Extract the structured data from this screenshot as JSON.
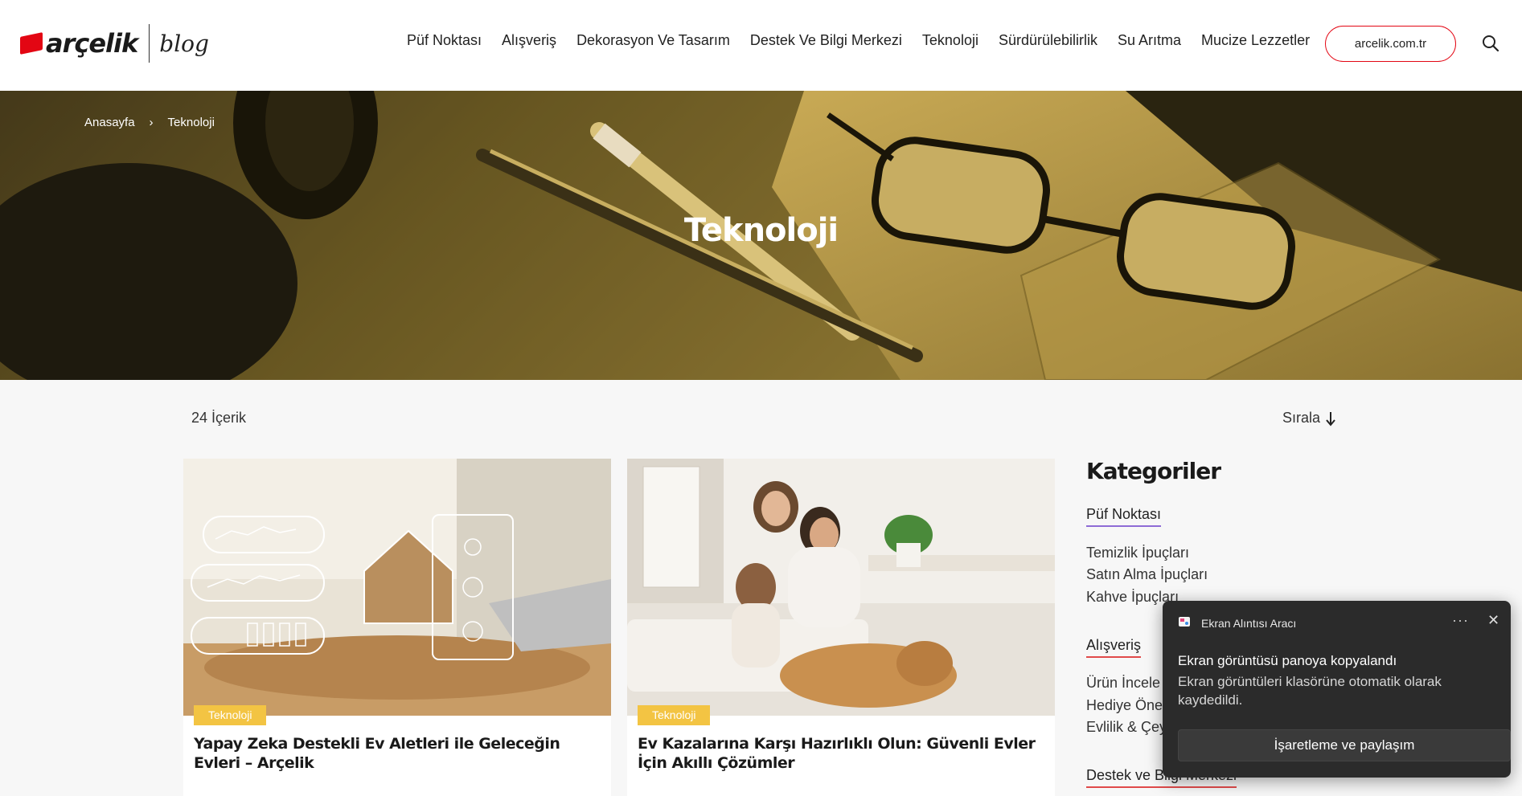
{
  "header": {
    "logo_text": "arçelik",
    "logo_sub": "blog",
    "nav": [
      "Püf Noktası",
      "Alışveriş",
      "Dekorasyon Ve Tasarım",
      "Destek Ve Bilgi Merkezi",
      "Teknoloji",
      "Sürdürülebilirlik",
      "Su Arıtma",
      "Mucize Lezzetler"
    ],
    "site_button": "arcelik.com.tr",
    "search_icon": "search-icon"
  },
  "hero": {
    "breadcrumb": {
      "home": "Anasayfa",
      "current": "Teknoloji"
    },
    "title": "Teknoloji"
  },
  "listing": {
    "count": "24 İçerik",
    "sort_label": "Sırala"
  },
  "cards": [
    {
      "tag": "Teknoloji",
      "title": "Yapay Zeka Destekli Ev Aletleri ile Geleceğin Evleri – Arçelik"
    },
    {
      "tag": "Teknoloji",
      "title": "Ev Kazalarına Karşı Hazırlıklı Olun: Güvenli Evler İçin Akıllı Çözümler"
    }
  ],
  "sidebar": {
    "title": "Kategoriler",
    "groups": [
      {
        "name": "Püf Noktası",
        "color": "#8e6bd6",
        "items": [
          "Temizlik İpuçları",
          "Satın Alma İpuçları",
          "Kahve İpuçları"
        ]
      },
      {
        "name": "Alışveriş",
        "color": "#e04a4a",
        "items": [
          "Ürün İncele",
          "Hediye Öne",
          "Evlilik & Çey"
        ]
      },
      {
        "name": "Destek ve Bilgi Merkezi",
        "color": "#e04a4a",
        "items": []
      }
    ]
  },
  "toast": {
    "app_name": "Ekran Alıntısı Aracı",
    "more": "···",
    "close": "✕",
    "message_title": "Ekran görüntüsü panoya kopyalandı",
    "message_body": "Ekran görüntüleri klasörüne otomatik olarak kaydedildi.",
    "action": "İşaretleme ve paylaşım"
  },
  "colors": {
    "brand_red": "#e30613",
    "tag_yellow": "#f3c443",
    "toast_bg": "#2b2b2b"
  }
}
